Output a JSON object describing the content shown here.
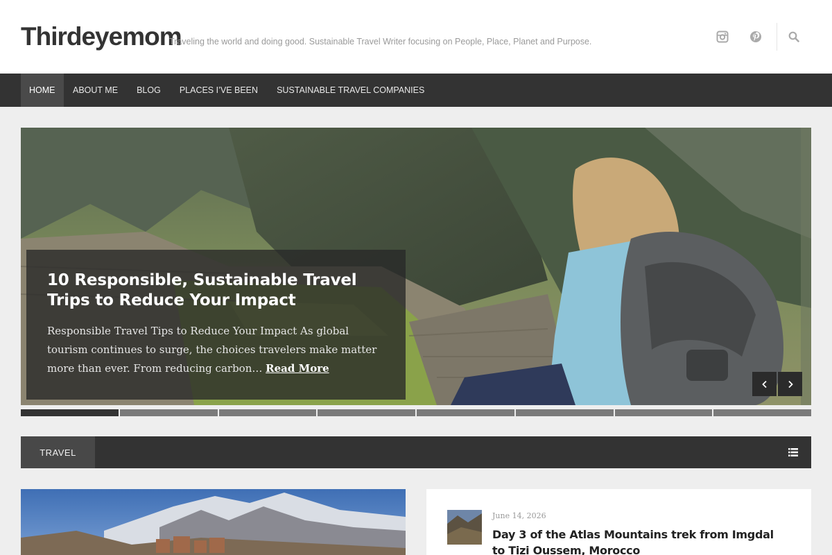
{
  "site": {
    "title": "Thirdeyemom",
    "tagline": "Traveling the world and doing good. Sustainable Travel Writer focusing on People, Place, Planet and Purpose."
  },
  "header_icons": [
    "instagram-icon",
    "pinterest-icon",
    "search-icon"
  ],
  "nav": {
    "items": [
      {
        "label": "HOME",
        "active": true
      },
      {
        "label": "ABOUT ME",
        "active": false
      },
      {
        "label": "BLOG",
        "active": false
      },
      {
        "label": "PLACES I’VE BEEN",
        "active": false
      },
      {
        "label": "SUSTAINABLE TRAVEL COMPANIES",
        "active": false
      }
    ]
  },
  "slider": {
    "title": "10 Responsible, Sustainable Travel Trips to Reduce Your Impact",
    "excerpt": "Responsible Travel Tips to Reduce Your Impact   As global tourism continues to surge, the choices travelers make matter more than ever. From reducing carbon…",
    "read_more": "Read More",
    "slide_count": 8,
    "active_slide": 1,
    "prev_icon": "chevron-left-icon",
    "next_icon": "chevron-right-icon"
  },
  "section": {
    "label": "TRAVEL",
    "icon": "list-icon"
  },
  "posts": [
    {
      "date": "June 14, 2026",
      "title": "Day 3 of the Atlas Mountains trek from Imgdal to Tizi Oussem, Morocco"
    }
  ],
  "colors": {
    "header_bg": "#ffffff",
    "nav_bg": "#333333",
    "nav_active_bg": "#4a4a4a",
    "page_bg": "#eeeeee",
    "caption_bg": "rgba(40,40,40,0.78)"
  }
}
